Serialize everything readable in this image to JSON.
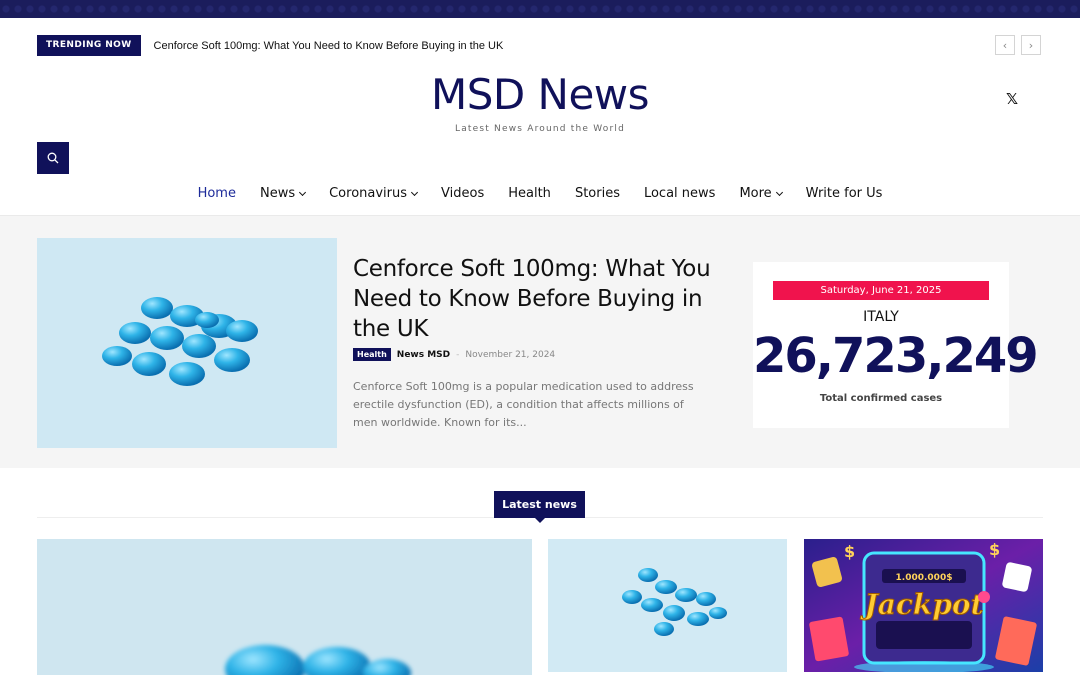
{
  "trending": {
    "label": "TRENDING NOW",
    "title": "Cenforce Soft 100mg: What You Need to Know Before Buying in the UK",
    "prev_icon": "‹",
    "next_icon": "›"
  },
  "site": {
    "name": "MSD News",
    "tagline": "Latest News Around the World",
    "social_icon": "𝕏"
  },
  "nav": {
    "items": [
      {
        "label": "Home",
        "active": true
      },
      {
        "label": "News",
        "dropdown": true
      },
      {
        "label": "Coronavirus",
        "dropdown": true
      },
      {
        "label": "Videos"
      },
      {
        "label": "Health"
      },
      {
        "label": "Stories"
      },
      {
        "label": "Local news"
      },
      {
        "label": "More",
        "dropdown": true
      },
      {
        "label": "Write for Us"
      }
    ]
  },
  "featured": {
    "title": "Cenforce Soft 100mg: What You Need to Know Before Buying in the UK",
    "category": "Health",
    "author": "News MSD",
    "separator": "-",
    "date": "November 21, 2024",
    "excerpt": "Cenforce Soft 100mg is a popular medication used to address erectile dysfunction (ED), a condition that affects millions of men worldwide. Known for its..."
  },
  "covid": {
    "date": "Saturday, June 21, 2025",
    "country": "ITALY",
    "count": "26,723,249",
    "label": "Total confirmed cases"
  },
  "latest": {
    "label": "Latest news",
    "card3_text": "Jackpot",
    "card3_amount": "1.000.000$"
  },
  "colors": {
    "brand": "#10115a",
    "accent_red": "#f0134d",
    "active_nav": "#1d2b9a"
  }
}
